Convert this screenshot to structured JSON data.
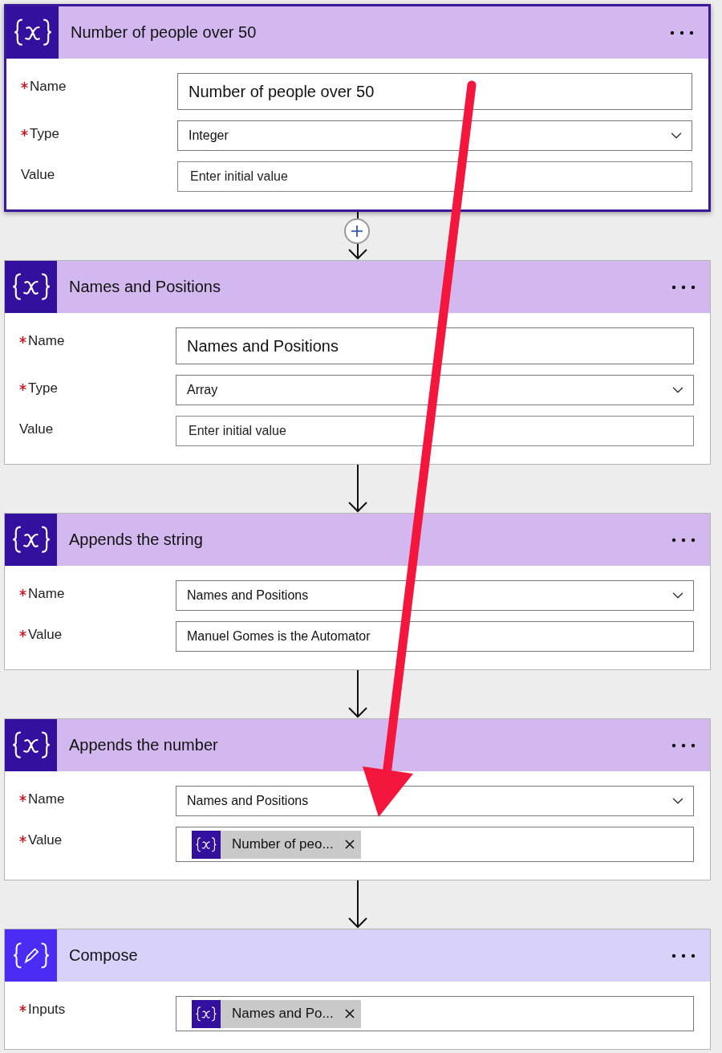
{
  "cards": [
    {
      "kind": "variable",
      "title": "Number of people over 50",
      "selected": true,
      "fields": [
        {
          "label": "Name",
          "required": true,
          "kind": "name",
          "value": "Number of people over 50"
        },
        {
          "label": "Type",
          "required": true,
          "kind": "dropdown",
          "value": "Integer"
        },
        {
          "label": "Value",
          "required": false,
          "kind": "empty",
          "placeholder": "Enter initial value"
        }
      ]
    },
    {
      "kind": "variable",
      "title": "Names and Positions",
      "selected": false,
      "add_button": true,
      "fields": [
        {
          "label": "Name",
          "required": true,
          "kind": "name",
          "value": "Names and Positions"
        },
        {
          "label": "Type",
          "required": true,
          "kind": "dropdown",
          "value": "Array"
        },
        {
          "label": "Value",
          "required": false,
          "kind": "empty",
          "placeholder": "Enter initial value"
        }
      ]
    },
    {
      "kind": "variable",
      "title": "Appends the string",
      "selected": false,
      "add_button": false,
      "fields": [
        {
          "label": "Name",
          "required": true,
          "kind": "dropdown",
          "value": "Names and Positions"
        },
        {
          "label": "Value",
          "required": true,
          "kind": "text",
          "value": "Manuel Gomes is the Automator"
        }
      ]
    },
    {
      "kind": "variable",
      "title": "Appends the number",
      "selected": false,
      "add_button": false,
      "fields": [
        {
          "label": "Name",
          "required": true,
          "kind": "dropdown",
          "value": "Names and Positions"
        },
        {
          "label": "Value",
          "required": true,
          "kind": "token",
          "token": "Number of peo..."
        }
      ]
    },
    {
      "kind": "compose",
      "title": "Compose",
      "selected": false,
      "add_button": false,
      "fields": [
        {
          "label": "Inputs",
          "required": true,
          "kind": "token",
          "token": "Names and Po..."
        }
      ]
    }
  ]
}
